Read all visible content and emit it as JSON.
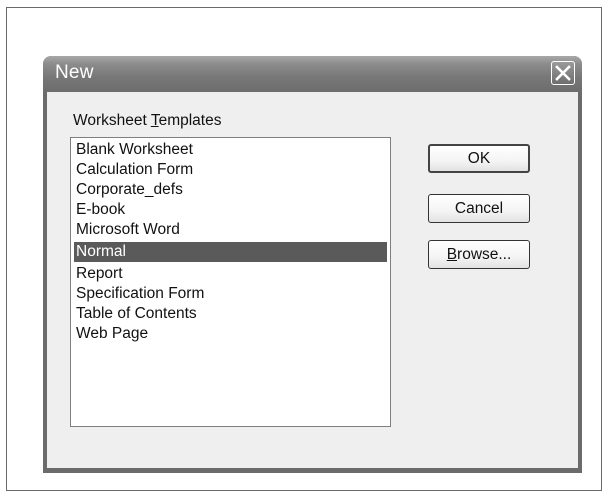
{
  "window": {
    "title": "New"
  },
  "templates": {
    "label_before": "Worksheet ",
    "label_mnemonic": "T",
    "label_after": "emplates",
    "items": [
      "Blank Worksheet",
      "Calculation Form",
      "Corporate_defs",
      "E-book",
      "Microsoft Word",
      "Normal",
      "Report",
      "Specification Form",
      "Table of Contents",
      "Web Page"
    ],
    "selected": "Normal"
  },
  "buttons": {
    "ok": "OK",
    "cancel": "Cancel",
    "browse_mnemonic": "B",
    "browse_rest": "rowse..."
  },
  "icons": {
    "close": "close-icon"
  }
}
